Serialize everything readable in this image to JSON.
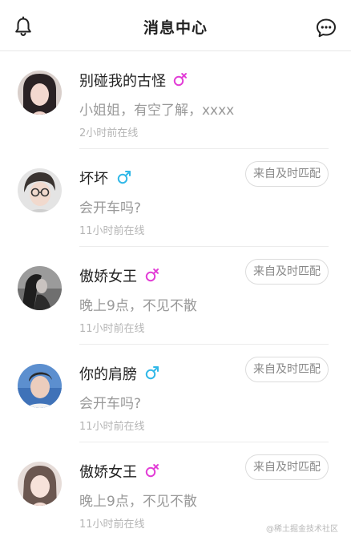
{
  "header": {
    "title": "消息中心",
    "left_icon": "bell-icon",
    "right_icon": "chat-bubble-icon"
  },
  "colors": {
    "female": "#e23dd6",
    "male": "#30b8e8",
    "badge_border": "#dcdcdc"
  },
  "items": [
    {
      "name": "别碰我的古怪",
      "gender": "female",
      "message": "小姐姐，有空了解，xxxx",
      "status": "2小时前在线",
      "badge": ""
    },
    {
      "name": "坏坏",
      "gender": "male",
      "message": "会开车吗?",
      "status": "11小时前在线",
      "badge": "来自及时匹配"
    },
    {
      "name": "傲娇女王",
      "gender": "female",
      "message": "晚上9点，不见不散",
      "status": "11小时前在线",
      "badge": "来自及时匹配"
    },
    {
      "name": "你的肩膀",
      "gender": "male",
      "message": "会开车吗?",
      "status": "11小时前在线",
      "badge": "来自及时匹配"
    },
    {
      "name": "傲娇女王",
      "gender": "female",
      "message": "晚上9点，不见不散",
      "status": "11小时前在线",
      "badge": "来自及时匹配"
    }
  ],
  "watermark": "@稀土掘金技术社区"
}
